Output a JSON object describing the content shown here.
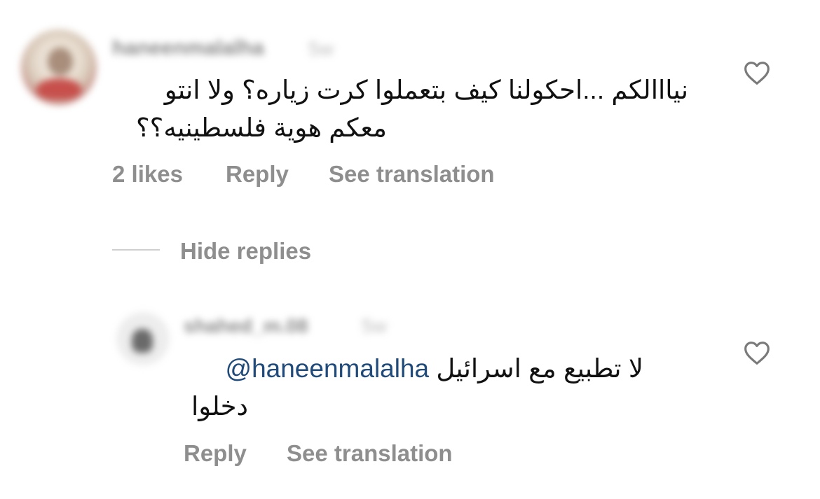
{
  "comment": {
    "username": "haneenmalalha",
    "time": "5w",
    "text_line1": "نيااالكم ...احكولنا كيف بتعملوا كرت زياره؟  ولا انتو",
    "text_line2": "معكم هوية فلسطينيه؟؟",
    "likes_label": "2 likes",
    "reply_label": "Reply",
    "translate_label": "See translation",
    "like_icon": "heart-outline-icon"
  },
  "thread": {
    "hide_replies_label": "Hide replies"
  },
  "reply": {
    "username": "shahed_m.08",
    "time": "5w",
    "text_line1": "لا تطبيع مع اسرائيل",
    "mention": "@haneenmalalha",
    "text_line2": "دخلوا",
    "reply_label": "Reply",
    "translate_label": "See translation",
    "like_icon": "heart-outline-icon"
  }
}
